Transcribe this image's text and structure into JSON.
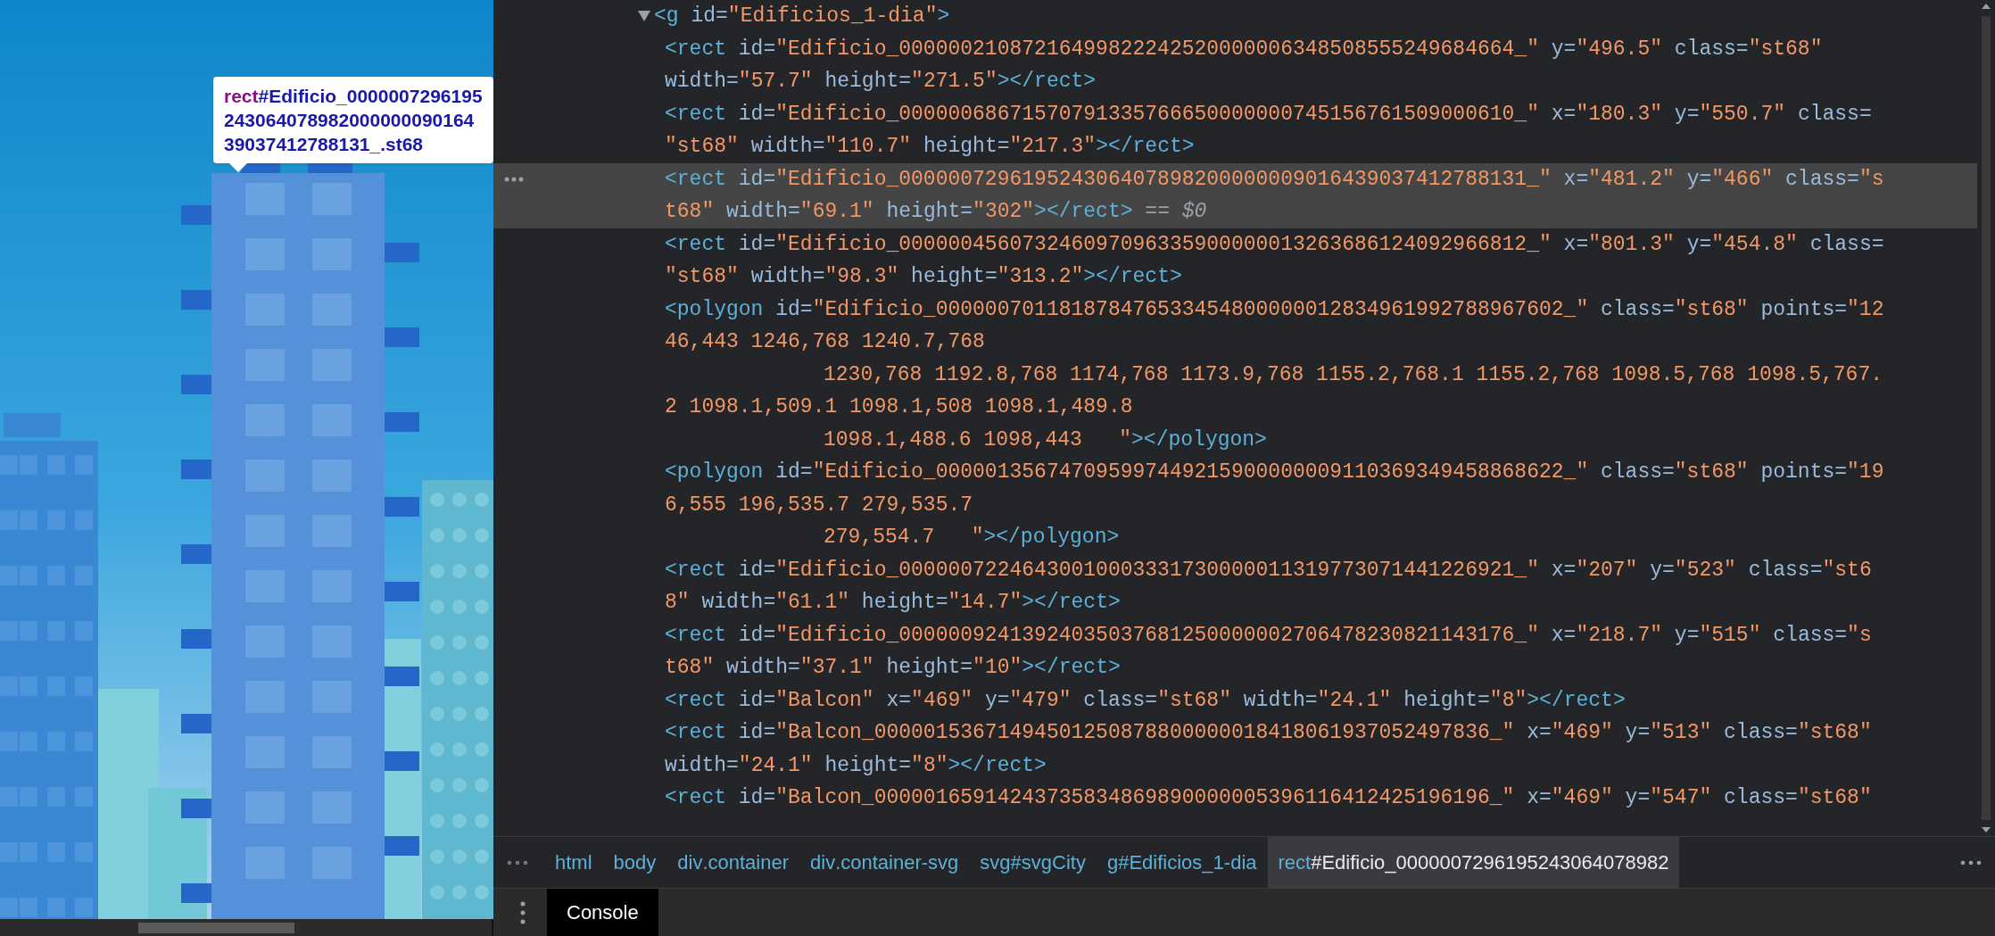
{
  "page_preview": {
    "tooltip": {
      "tag": "rect",
      "selector": "#Edificio_000000729619524306407898200000009016439037412788131_.st68"
    }
  },
  "elements": {
    "expanded": true,
    "open_tag": [
      {
        "kind": "tag",
        "text": "<g"
      },
      {
        "kind": "attr",
        "text": " id="
      },
      {
        "kind": "value",
        "text": "\"Edificios_1-dia\""
      },
      {
        "kind": "tag",
        "text": ">"
      }
    ],
    "children": [
      {
        "selected": false,
        "lines": [
          {
            "kind": "start",
            "tokens": [
              {
                "kind": "tag",
                "text": "<rect"
              },
              {
                "kind": "attr",
                "text": " id="
              },
              {
                "kind": "value",
                "text": "\"Edificio_00000021087216499822242520000006348508555249684664_\""
              },
              {
                "kind": "attr",
                "text": " y="
              },
              {
                "kind": "value",
                "text": "\"496.5\""
              },
              {
                "kind": "attr",
                "text": " class="
              },
              {
                "kind": "value",
                "text": "\"st68\""
              }
            ]
          },
          {
            "kind": "wrap",
            "tokens": [
              {
                "kind": "attr",
                "text": "width="
              },
              {
                "kind": "value",
                "text": "\"57.7\""
              },
              {
                "kind": "attr",
                "text": " height="
              },
              {
                "kind": "value",
                "text": "\"271.5\""
              },
              {
                "kind": "tag",
                "text": "></rect>"
              }
            ]
          }
        ]
      },
      {
        "selected": false,
        "lines": [
          {
            "kind": "start",
            "tokens": [
              {
                "kind": "tag",
                "text": "<rect"
              },
              {
                "kind": "attr",
                "text": " id="
              },
              {
                "kind": "value",
                "text": "\"Edificio_00000068671570791335766650000000745156761509000610_\""
              },
              {
                "kind": "attr",
                "text": " x="
              },
              {
                "kind": "value",
                "text": "\"180.3\""
              },
              {
                "kind": "attr",
                "text": " y="
              },
              {
                "kind": "value",
                "text": "\"550.7\""
              },
              {
                "kind": "attr",
                "text": " class="
              }
            ]
          },
          {
            "kind": "wrap",
            "tokens": [
              {
                "kind": "value",
                "text": "\"st68\""
              },
              {
                "kind": "attr",
                "text": " width="
              },
              {
                "kind": "value",
                "text": "\"110.7\""
              },
              {
                "kind": "attr",
                "text": " height="
              },
              {
                "kind": "value",
                "text": "\"217.3\""
              },
              {
                "kind": "tag",
                "text": "></rect>"
              }
            ]
          }
        ]
      },
      {
        "selected": true,
        "lines": [
          {
            "kind": "start",
            "tokens": [
              {
                "kind": "tag",
                "text": "<rect"
              },
              {
                "kind": "attr",
                "text": " id="
              },
              {
                "kind": "value",
                "text": "\"Edificio_000000729619524306407898200000009016439037412788131_\""
              },
              {
                "kind": "attr",
                "text": " x="
              },
              {
                "kind": "value",
                "text": "\"481.2\""
              },
              {
                "kind": "attr",
                "text": " y="
              },
              {
                "kind": "value",
                "text": "\"466\""
              },
              {
                "kind": "attr",
                "text": " class="
              },
              {
                "kind": "value",
                "text": "\"s"
              }
            ]
          },
          {
            "kind": "wrap",
            "tokens": [
              {
                "kind": "value",
                "text": "t68\""
              },
              {
                "kind": "attr",
                "text": " width="
              },
              {
                "kind": "value",
                "text": "\"69.1\""
              },
              {
                "kind": "attr",
                "text": " height="
              },
              {
                "kind": "value",
                "text": "\"302\""
              },
              {
                "kind": "tag",
                "text": "></rect>"
              },
              {
                "kind": "text",
                "text": " == "
              },
              {
                "kind": "marker",
                "text": "$0"
              }
            ]
          }
        ]
      },
      {
        "selected": false,
        "lines": [
          {
            "kind": "start",
            "tokens": [
              {
                "kind": "tag",
                "text": "<rect"
              },
              {
                "kind": "attr",
                "text": " id="
              },
              {
                "kind": "value",
                "text": "\"Edificio_000000456073246097096335900000013263686124092966812_\""
              },
              {
                "kind": "attr",
                "text": " x="
              },
              {
                "kind": "value",
                "text": "\"801.3\""
              },
              {
                "kind": "attr",
                "text": " y="
              },
              {
                "kind": "value",
                "text": "\"454.8\""
              },
              {
                "kind": "attr",
                "text": " class="
              }
            ]
          },
          {
            "kind": "wrap",
            "tokens": [
              {
                "kind": "value",
                "text": "\"st68\""
              },
              {
                "kind": "attr",
                "text": " width="
              },
              {
                "kind": "value",
                "text": "\"98.3\""
              },
              {
                "kind": "attr",
                "text": " height="
              },
              {
                "kind": "value",
                "text": "\"313.2\""
              },
              {
                "kind": "tag",
                "text": "></rect>"
              }
            ]
          }
        ]
      },
      {
        "selected": false,
        "lines": [
          {
            "kind": "start",
            "tokens": [
              {
                "kind": "tag",
                "text": "<polygon"
              },
              {
                "kind": "attr",
                "text": " id="
              },
              {
                "kind": "value",
                "text": "\"Edificio_000000701181878476533454800000012834961992788967602_\""
              },
              {
                "kind": "attr",
                "text": " class="
              },
              {
                "kind": "value",
                "text": "\"st68\""
              },
              {
                "kind": "attr",
                "text": " points="
              },
              {
                "kind": "value",
                "text": "\"12"
              }
            ]
          },
          {
            "kind": "wrap",
            "tokens": [
              {
                "kind": "value",
                "text": "46,443 1246,768 1240.7,768"
              }
            ]
          },
          {
            "kind": "continued",
            "tokens": [
              {
                "kind": "value",
                "text": "1230,768 1192.8,768 1174,768 1173.9,768 1155.2,768.1 1155.2,768 1098.5,768 1098.5,767."
              }
            ]
          },
          {
            "kind": "wrap",
            "tokens": [
              {
                "kind": "value",
                "text": "2 1098.1,509.1 1098.1,508 1098.1,489.8"
              }
            ]
          },
          {
            "kind": "continued",
            "tokens": [
              {
                "kind": "value",
                "text": "1098.1,488.6 1098,443   \""
              },
              {
                "kind": "tag",
                "text": "></polygon>"
              }
            ]
          }
        ]
      },
      {
        "selected": false,
        "lines": [
          {
            "kind": "start",
            "tokens": [
              {
                "kind": "tag",
                "text": "<polygon"
              },
              {
                "kind": "attr",
                "text": " id="
              },
              {
                "kind": "value",
                "text": "\"Edificio_000001356747095997449215900000009110369349458868622_\""
              },
              {
                "kind": "attr",
                "text": " class="
              },
              {
                "kind": "value",
                "text": "\"st68\""
              },
              {
                "kind": "attr",
                "text": " points="
              },
              {
                "kind": "value",
                "text": "\"19"
              }
            ]
          },
          {
            "kind": "wrap",
            "tokens": [
              {
                "kind": "value",
                "text": "6,555 196,535.7 279,535.7"
              }
            ]
          },
          {
            "kind": "continued",
            "tokens": [
              {
                "kind": "value",
                "text": "279,554.7   \""
              },
              {
                "kind": "tag",
                "text": "></polygon>"
              }
            ]
          }
        ]
      },
      {
        "selected": false,
        "lines": [
          {
            "kind": "start",
            "tokens": [
              {
                "kind": "tag",
                "text": "<rect"
              },
              {
                "kind": "attr",
                "text": " id="
              },
              {
                "kind": "value",
                "text": "\"Edificio_00000072246430010003331730000011319773071441226921_\""
              },
              {
                "kind": "attr",
                "text": " x="
              },
              {
                "kind": "value",
                "text": "\"207\""
              },
              {
                "kind": "attr",
                "text": " y="
              },
              {
                "kind": "value",
                "text": "\"523\""
              },
              {
                "kind": "attr",
                "text": " class="
              },
              {
                "kind": "value",
                "text": "\"st6"
              }
            ]
          },
          {
            "kind": "wrap",
            "tokens": [
              {
                "kind": "value",
                "text": "8\""
              },
              {
                "kind": "attr",
                "text": " width="
              },
              {
                "kind": "value",
                "text": "\"61.1\""
              },
              {
                "kind": "attr",
                "text": " height="
              },
              {
                "kind": "value",
                "text": "\"14.7\""
              },
              {
                "kind": "tag",
                "text": "></rect>"
              }
            ]
          }
        ]
      },
      {
        "selected": false,
        "lines": [
          {
            "kind": "start",
            "tokens": [
              {
                "kind": "tag",
                "text": "<rect"
              },
              {
                "kind": "attr",
                "text": " id="
              },
              {
                "kind": "value",
                "text": "\"Edificio_00000092413924035037681250000002706478230821143176_\""
              },
              {
                "kind": "attr",
                "text": " x="
              },
              {
                "kind": "value",
                "text": "\"218.7\""
              },
              {
                "kind": "attr",
                "text": " y="
              },
              {
                "kind": "value",
                "text": "\"515\""
              },
              {
                "kind": "attr",
                "text": " class="
              },
              {
                "kind": "value",
                "text": "\"s"
              }
            ]
          },
          {
            "kind": "wrap",
            "tokens": [
              {
                "kind": "value",
                "text": "t68\""
              },
              {
                "kind": "attr",
                "text": " width="
              },
              {
                "kind": "value",
                "text": "\"37.1\""
              },
              {
                "kind": "attr",
                "text": " height="
              },
              {
                "kind": "value",
                "text": "\"10\""
              },
              {
                "kind": "tag",
                "text": "></rect>"
              }
            ]
          }
        ]
      },
      {
        "selected": false,
        "lines": [
          {
            "kind": "start",
            "tokens": [
              {
                "kind": "tag",
                "text": "<rect"
              },
              {
                "kind": "attr",
                "text": " id="
              },
              {
                "kind": "value",
                "text": "\"Balcon\""
              },
              {
                "kind": "attr",
                "text": " x="
              },
              {
                "kind": "value",
                "text": "\"469\""
              },
              {
                "kind": "attr",
                "text": " y="
              },
              {
                "kind": "value",
                "text": "\"479\""
              },
              {
                "kind": "attr",
                "text": " class="
              },
              {
                "kind": "value",
                "text": "\"st68\""
              },
              {
                "kind": "attr",
                "text": " width="
              },
              {
                "kind": "value",
                "text": "\"24.1\""
              },
              {
                "kind": "attr",
                "text": " height="
              },
              {
                "kind": "value",
                "text": "\"8\""
              },
              {
                "kind": "tag",
                "text": "></rect>"
              }
            ]
          }
        ]
      },
      {
        "selected": false,
        "lines": [
          {
            "kind": "start",
            "tokens": [
              {
                "kind": "tag",
                "text": "<rect"
              },
              {
                "kind": "attr",
                "text": " id="
              },
              {
                "kind": "value",
                "text": "\"Balcon_00000153671494501250878800000018418061937052497836_\""
              },
              {
                "kind": "attr",
                "text": " x="
              },
              {
                "kind": "value",
                "text": "\"469\""
              },
              {
                "kind": "attr",
                "text": " y="
              },
              {
                "kind": "value",
                "text": "\"513\""
              },
              {
                "kind": "attr",
                "text": " class="
              },
              {
                "kind": "value",
                "text": "\"st68\""
              }
            ]
          },
          {
            "kind": "wrap",
            "tokens": [
              {
                "kind": "attr",
                "text": "width="
              },
              {
                "kind": "value",
                "text": "\"24.1\""
              },
              {
                "kind": "attr",
                "text": " height="
              },
              {
                "kind": "value",
                "text": "\"8\""
              },
              {
                "kind": "tag",
                "text": "></rect>"
              }
            ]
          }
        ]
      },
      {
        "selected": false,
        "lines": [
          {
            "kind": "start",
            "tokens": [
              {
                "kind": "tag",
                "text": "<rect"
              },
              {
                "kind": "attr",
                "text": " id="
              },
              {
                "kind": "value",
                "text": "\"Balcon_00000165914243735834869890000005396116412425196196_\""
              },
              {
                "kind": "attr",
                "text": " x="
              },
              {
                "kind": "value",
                "text": "\"469\""
              },
              {
                "kind": "attr",
                "text": " y="
              },
              {
                "kind": "value",
                "text": "\"547\""
              },
              {
                "kind": "attr",
                "text": " class="
              },
              {
                "kind": "value",
                "text": "\"st68\""
              }
            ]
          }
        ]
      }
    ]
  },
  "breadcrumbs": [
    {
      "tag": "html",
      "selected": false
    },
    {
      "tag": "body",
      "selected": false
    },
    {
      "tag": "div",
      "rest": ".container",
      "selected": false
    },
    {
      "tag": "div",
      "rest": ".container-svg",
      "selected": false
    },
    {
      "tag": "svg",
      "rest": "#svgCity",
      "selected": false
    },
    {
      "tag": "g",
      "rest": "#Edificios_1-dia",
      "selected": false
    },
    {
      "tag": "rect",
      "rest": "#Edificio_0000007296195243064078982",
      "selected": true
    }
  ],
  "drawer": {
    "tabs": [
      {
        "label": "Console",
        "selected": true
      }
    ]
  }
}
